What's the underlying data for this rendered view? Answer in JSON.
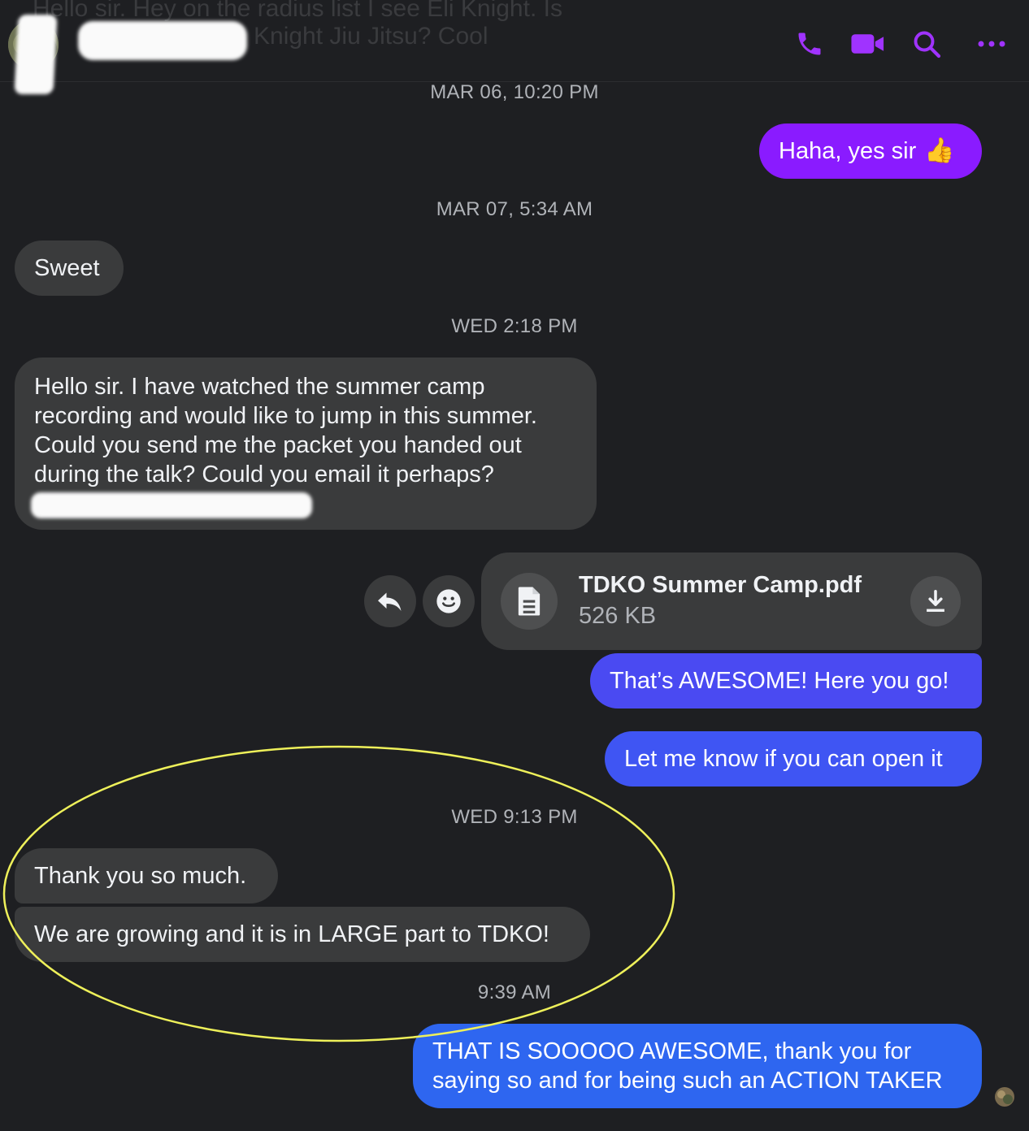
{
  "header": {
    "ghost_line1": "Hello sir. Hey on the radius list I see Eli Knight. Is",
    "ghost_line2": "Knight Jiu Jitsu? Cool",
    "contact_name": "",
    "icons": [
      "phone-icon",
      "video-camera-icon",
      "search-icon",
      "more-icon"
    ],
    "accent_color": "#a033ff"
  },
  "messages": {
    "ts1": "MAR 06, 10:20 PM",
    "m1": "Haha, yes sir",
    "m1_emoji": "👍",
    "ts2": "MAR 07, 5:34 AM",
    "m2": "Sweet",
    "ts3": "WED 2:18 PM",
    "m3_lines": [
      "Hello sir. I have watched the summer camp",
      "recording and would like to jump in this summer.",
      "Could you send me the packet you handed out",
      "during the talk? Could you email it perhaps?"
    ],
    "attachment": {
      "filename": "TDKO Summer Camp.pdf",
      "size": "526 KB"
    },
    "m4": "That’s AWESOME! Here you go!",
    "m5": "Let me know if you can open it",
    "ts4": "WED 9:13 PM",
    "m6": "Thank you so much.",
    "m7": "We are growing and it is in LARGE part to TDKO!",
    "ts5": "9:39 AM",
    "m8_lines": [
      "THAT IS SOOOOO AWESOME, thank you for",
      "saying so and for being such an ACTION TAKER"
    ]
  },
  "colors": {
    "purple_bubble": "#8a1bff",
    "blue_violet_bubble": "#4a4af2",
    "blue_bubble": "#2e66f0",
    "incoming_bubble": "#3a3b3c",
    "annotation_ellipse": "#eef05a"
  }
}
